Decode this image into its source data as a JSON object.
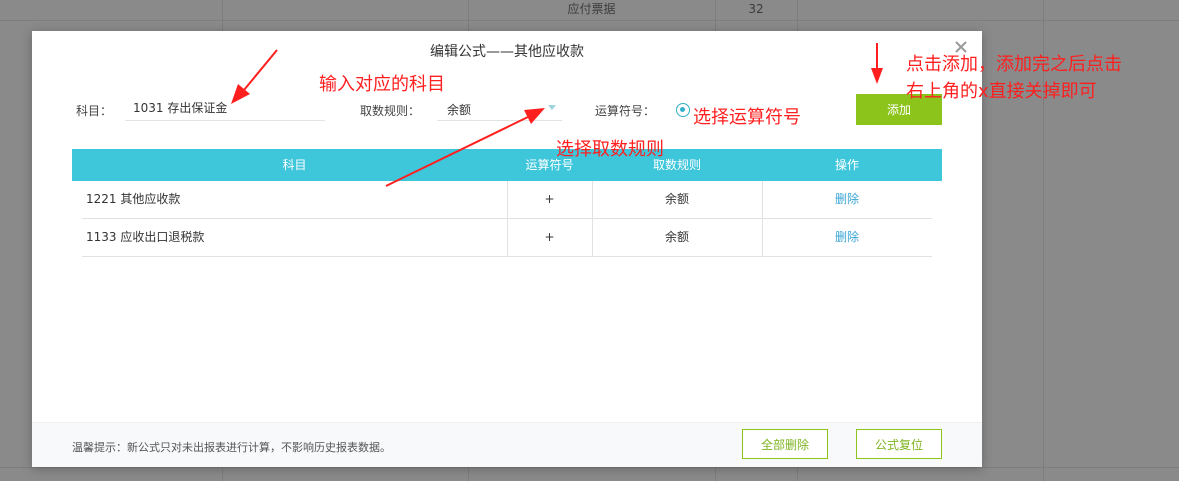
{
  "background": {
    "visible_cells": [
      {
        "text": "应付票据"
      },
      {
        "text": "32"
      }
    ]
  },
  "dialog": {
    "title": "编辑公式——其他应收款",
    "close_icon": "close-icon",
    "form": {
      "subject_label": "科目：",
      "subject_value": "1031 存出保证金",
      "rule_label": "取数规则：",
      "rule_value": "余额",
      "operator_label": "运算符号：",
      "operator_selected": "+",
      "add_button": "添加"
    },
    "table": {
      "columns": [
        "科目",
        "运算符号",
        "取数规则",
        "操作"
      ],
      "rows": [
        {
          "subject": "1221 其他应收款",
          "operator": "+",
          "rule": "余额",
          "action": "删除"
        },
        {
          "subject": "1133 应收出口退税款",
          "operator": "+",
          "rule": "余额",
          "action": "删除"
        }
      ]
    },
    "footer": {
      "tip": "温馨提示：新公式只对未出报表进行计算，不影响历史报表数据。",
      "delete_all_button": "全部删除",
      "reset_button": "公式复位"
    }
  },
  "annotations": {
    "subject_hint": "输入对应的科目",
    "rule_hint": "选择取数规则",
    "operator_hint": "选择运算符号",
    "add_hint_line1": "点击添加，添加完之后点击",
    "add_hint_line2": "右上角的x直接关掉即可",
    "color": "#ff1f1f"
  },
  "colors": {
    "table_header": "#3ec6db",
    "primary_button": "#8cc41b",
    "link": "#3ba6d6"
  }
}
